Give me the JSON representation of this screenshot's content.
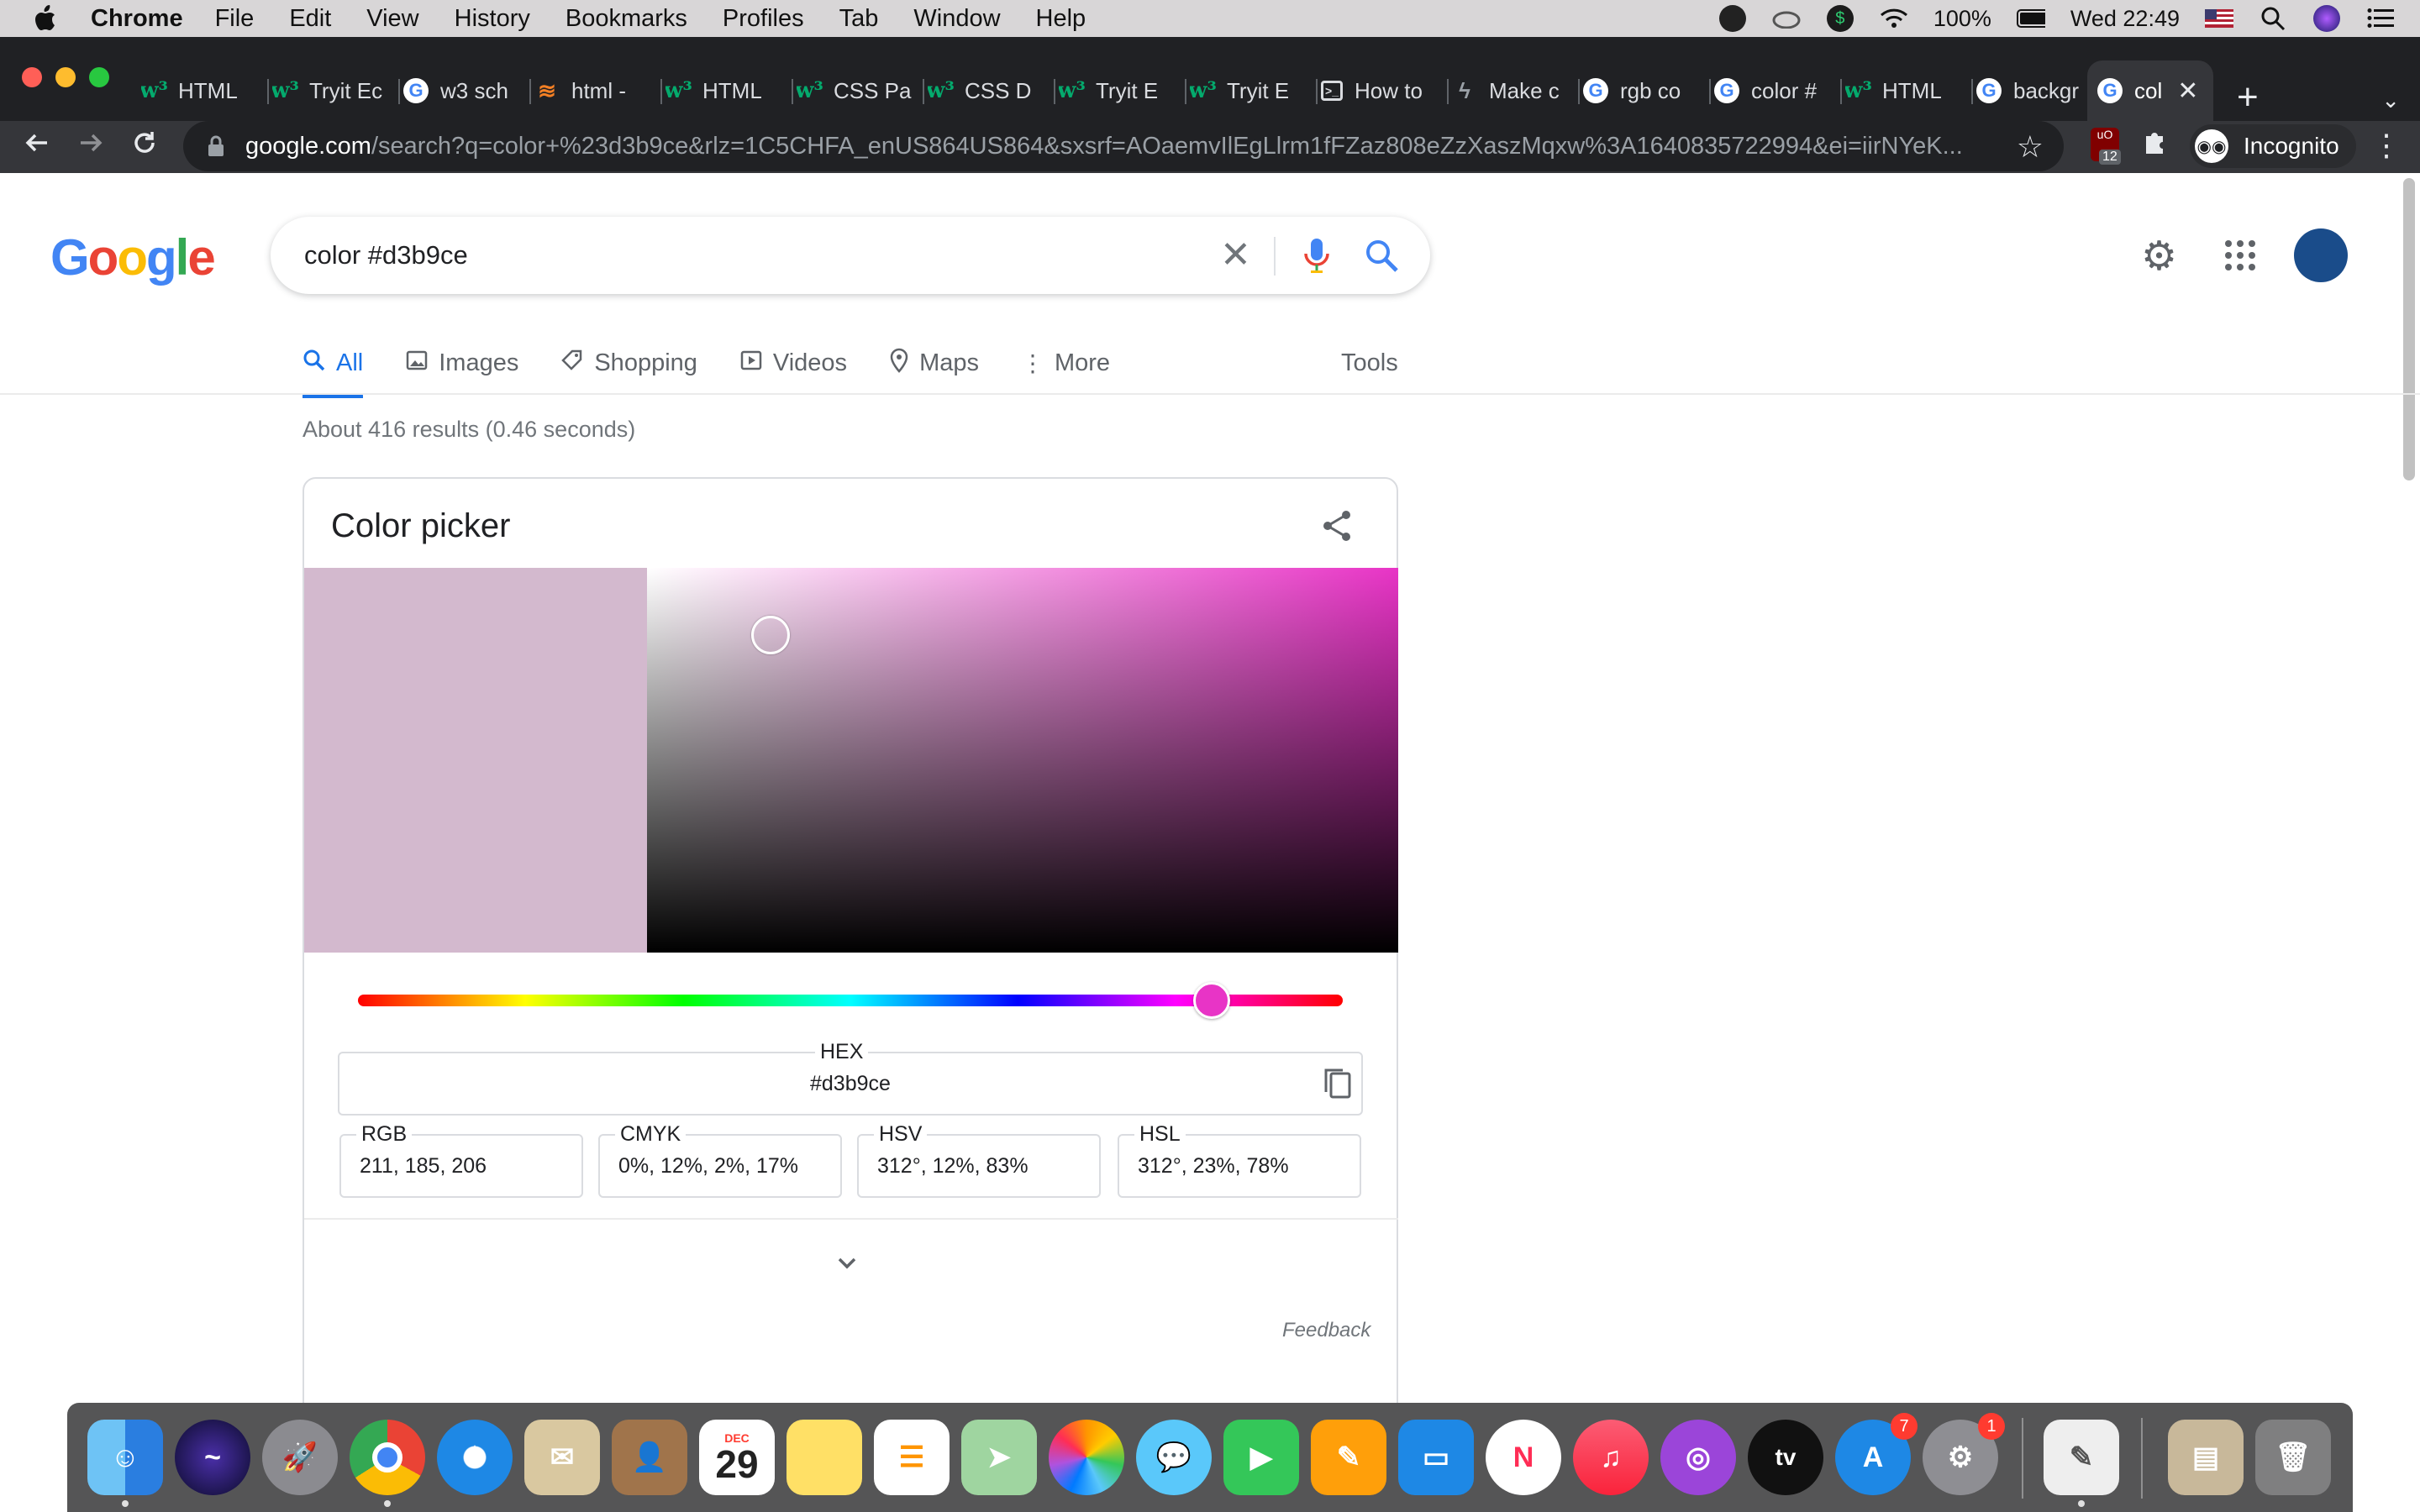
{
  "menubar": {
    "app_name": "Chrome",
    "items": [
      "File",
      "Edit",
      "View",
      "History",
      "Bookmarks",
      "Profiles",
      "Tab",
      "Window",
      "Help"
    ],
    "battery": "100%",
    "clock": "Wed 22:49"
  },
  "tabs": [
    {
      "icon": "w3schools-icon",
      "title": "HTML"
    },
    {
      "icon": "w3schools-icon",
      "title": "Tryit Ec"
    },
    {
      "icon": "google-icon",
      "title": "w3 sch"
    },
    {
      "icon": "stackoverflow-icon",
      "title": "html -"
    },
    {
      "icon": "w3schools-icon",
      "title": "HTML"
    },
    {
      "icon": "w3schools-icon",
      "title": "CSS Pa"
    },
    {
      "icon": "w3schools-icon",
      "title": "CSS D"
    },
    {
      "icon": "w3schools-icon",
      "title": "Tryit E"
    },
    {
      "icon": "w3schools-icon",
      "title": "Tryit E"
    },
    {
      "icon": "terminal-icon",
      "title": "How to"
    },
    {
      "icon": "make-icon",
      "title": "Make c"
    },
    {
      "icon": "google-icon",
      "title": "rgb co"
    },
    {
      "icon": "google-icon",
      "title": "color #"
    },
    {
      "icon": "w3schools-icon",
      "title": "HTML"
    },
    {
      "icon": "google-icon",
      "title": "backgr"
    },
    {
      "icon": "google-icon",
      "title": "col",
      "active": true
    }
  ],
  "address_bar": {
    "domain": "google.com",
    "path": "/search?q=color+%23d3b9ce&rlz=1C5CHFA_enUS864US864&sxsrf=AOaemvIlEgLlrm1fFZaz808eZzXaszMqxw%3A1640835722994&ei=iirNYeK...",
    "extension_badge": "12",
    "incognito_label": "Incognito"
  },
  "search": {
    "query": "color #d3b9ce"
  },
  "nav_tabs": [
    {
      "label": "All",
      "icon": "search-icon",
      "active": true
    },
    {
      "label": "Images",
      "icon": "image-icon"
    },
    {
      "label": "Shopping",
      "icon": "tag-icon"
    },
    {
      "label": "Videos",
      "icon": "play-icon"
    },
    {
      "label": "Maps",
      "icon": "map-pin-icon"
    },
    {
      "label": "More",
      "icon": "more-vert-icon"
    }
  ],
  "tools_label": "Tools",
  "result_stats": "About 416 results (0.46 seconds)",
  "color_picker": {
    "title": "Color picker",
    "color": "#d3b9ce",
    "hue_color": "#e834c6",
    "hue_degrees": 312,
    "saturation_fraction": 0.12,
    "value_fraction": 0.83,
    "hex_label": "HEX",
    "hex_value": "#d3b9ce",
    "rgb_label": "RGB",
    "rgb_value": "211, 185, 206",
    "cmyk_label": "CMYK",
    "cmyk_value": "0%, 12%, 2%, 17%",
    "hsv_label": "HSV",
    "hsv_value": "312°, 12%, 83%",
    "hsl_label": "HSL",
    "hsl_value": "312°, 23%, 78%"
  },
  "feedback_label": "Feedback",
  "dock": {
    "apps": [
      "finder",
      "siri",
      "launchpad",
      "chrome",
      "safari",
      "mail",
      "contacts",
      "calendar",
      "notes",
      "reminders",
      "maps",
      "photos",
      "messages",
      "facetime",
      "pages",
      "keynote",
      "news",
      "music",
      "podcasts",
      "tv",
      "app-store",
      "system-preferences",
      "textedit",
      "archive",
      "trash"
    ],
    "calendar_month": "DEC",
    "calendar_day": "29",
    "tv_label": "tv",
    "app_store_badge": "7",
    "system_prefs_badge": "1"
  }
}
